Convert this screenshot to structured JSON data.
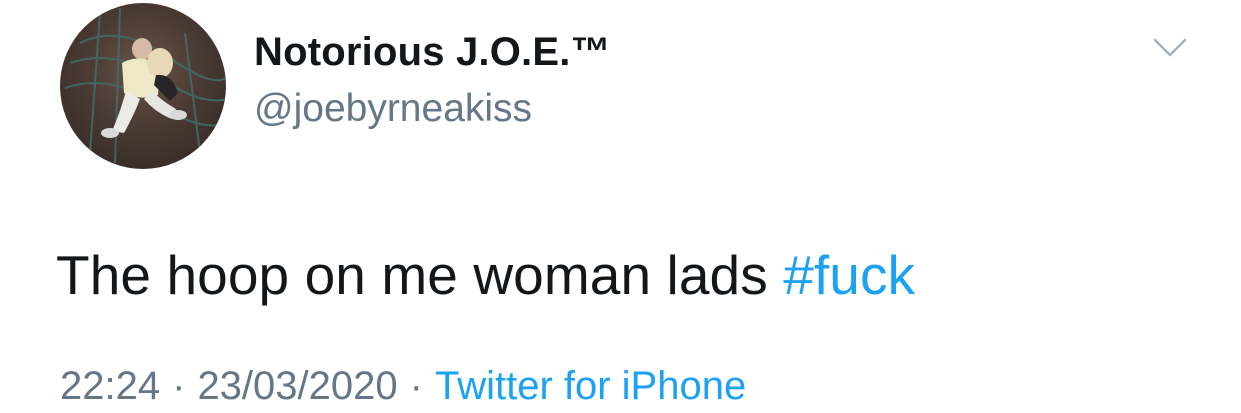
{
  "author": {
    "display_name": "Notorious J.O.E.™",
    "handle": "@joebyrneakiss"
  },
  "tweet": {
    "text": "The hoop on me woman lads",
    "hashtag": "#fuck"
  },
  "meta": {
    "time": "22:24",
    "separator": "·",
    "date": "23/03/2020",
    "source": "Twitter for iPhone"
  },
  "colors": {
    "text": "#14171a",
    "secondary": "#657786",
    "link": "#1da1f2"
  },
  "icons": {
    "caret": "chevron-down-icon"
  }
}
